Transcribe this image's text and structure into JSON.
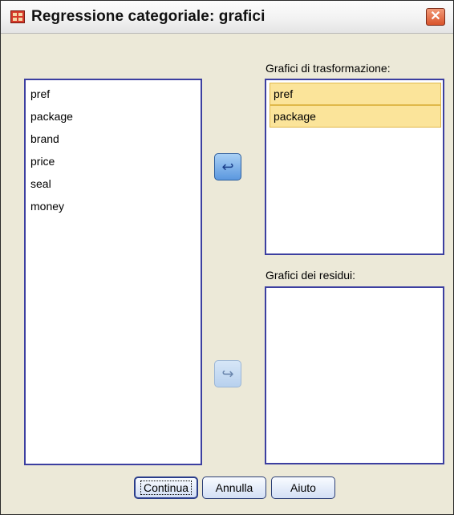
{
  "window": {
    "title": "Regressione categoriale: grafici",
    "close_icon": "close-x-icon",
    "app_icon": "spss-grid-icon"
  },
  "available_variables": {
    "items": [
      "pref",
      "package",
      "brand",
      "price",
      "seal",
      "money"
    ]
  },
  "transformation_plots": {
    "label": "Grafici di trasformazione:",
    "items": [
      "pref",
      "package"
    ]
  },
  "residual_plots": {
    "label": "Grafici dei residui:",
    "items": []
  },
  "move_buttons": {
    "to_transformation_icon": "arrow-left-curved-icon",
    "to_residual_icon": "arrow-right-curved-icon"
  },
  "buttons": {
    "continue": "Continua",
    "cancel": "Annulla",
    "help": "Aiuto"
  },
  "colors": {
    "selection_fill": "#fbe49a",
    "panel_border": "#3c3fa0",
    "dialog_bg": "#ece9d8"
  }
}
